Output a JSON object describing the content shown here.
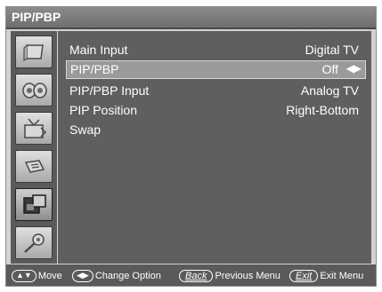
{
  "window": {
    "title": "PIP/PBP"
  },
  "sidebar": {
    "items": [
      {
        "icon": "picture-icon"
      },
      {
        "icon": "sound-icon"
      },
      {
        "icon": "channel-icon"
      },
      {
        "icon": "setup-icon"
      },
      {
        "icon": "pip-icon"
      },
      {
        "icon": "support-icon"
      }
    ],
    "active_index": 4
  },
  "menu": {
    "rows": [
      {
        "label": "Main Input",
        "value": "Digital TV"
      },
      {
        "label": "PIP/PBP",
        "value": "Off",
        "arrows": "◀▶"
      },
      {
        "label": "PIP/PBP Input",
        "value": "Analog TV"
      },
      {
        "label": "PIP Position",
        "value": "Right-Bottom"
      },
      {
        "label": "Swap",
        "value": ""
      }
    ],
    "selected_index": 1
  },
  "footer": {
    "move_key": "▲▼",
    "move_label": "Move",
    "change_key": "◀▶",
    "change_label": "Change Option",
    "back_key": "Back",
    "back_label": "Previous Menu",
    "exit_key": "Exit",
    "exit_label": "Exit Menu"
  }
}
